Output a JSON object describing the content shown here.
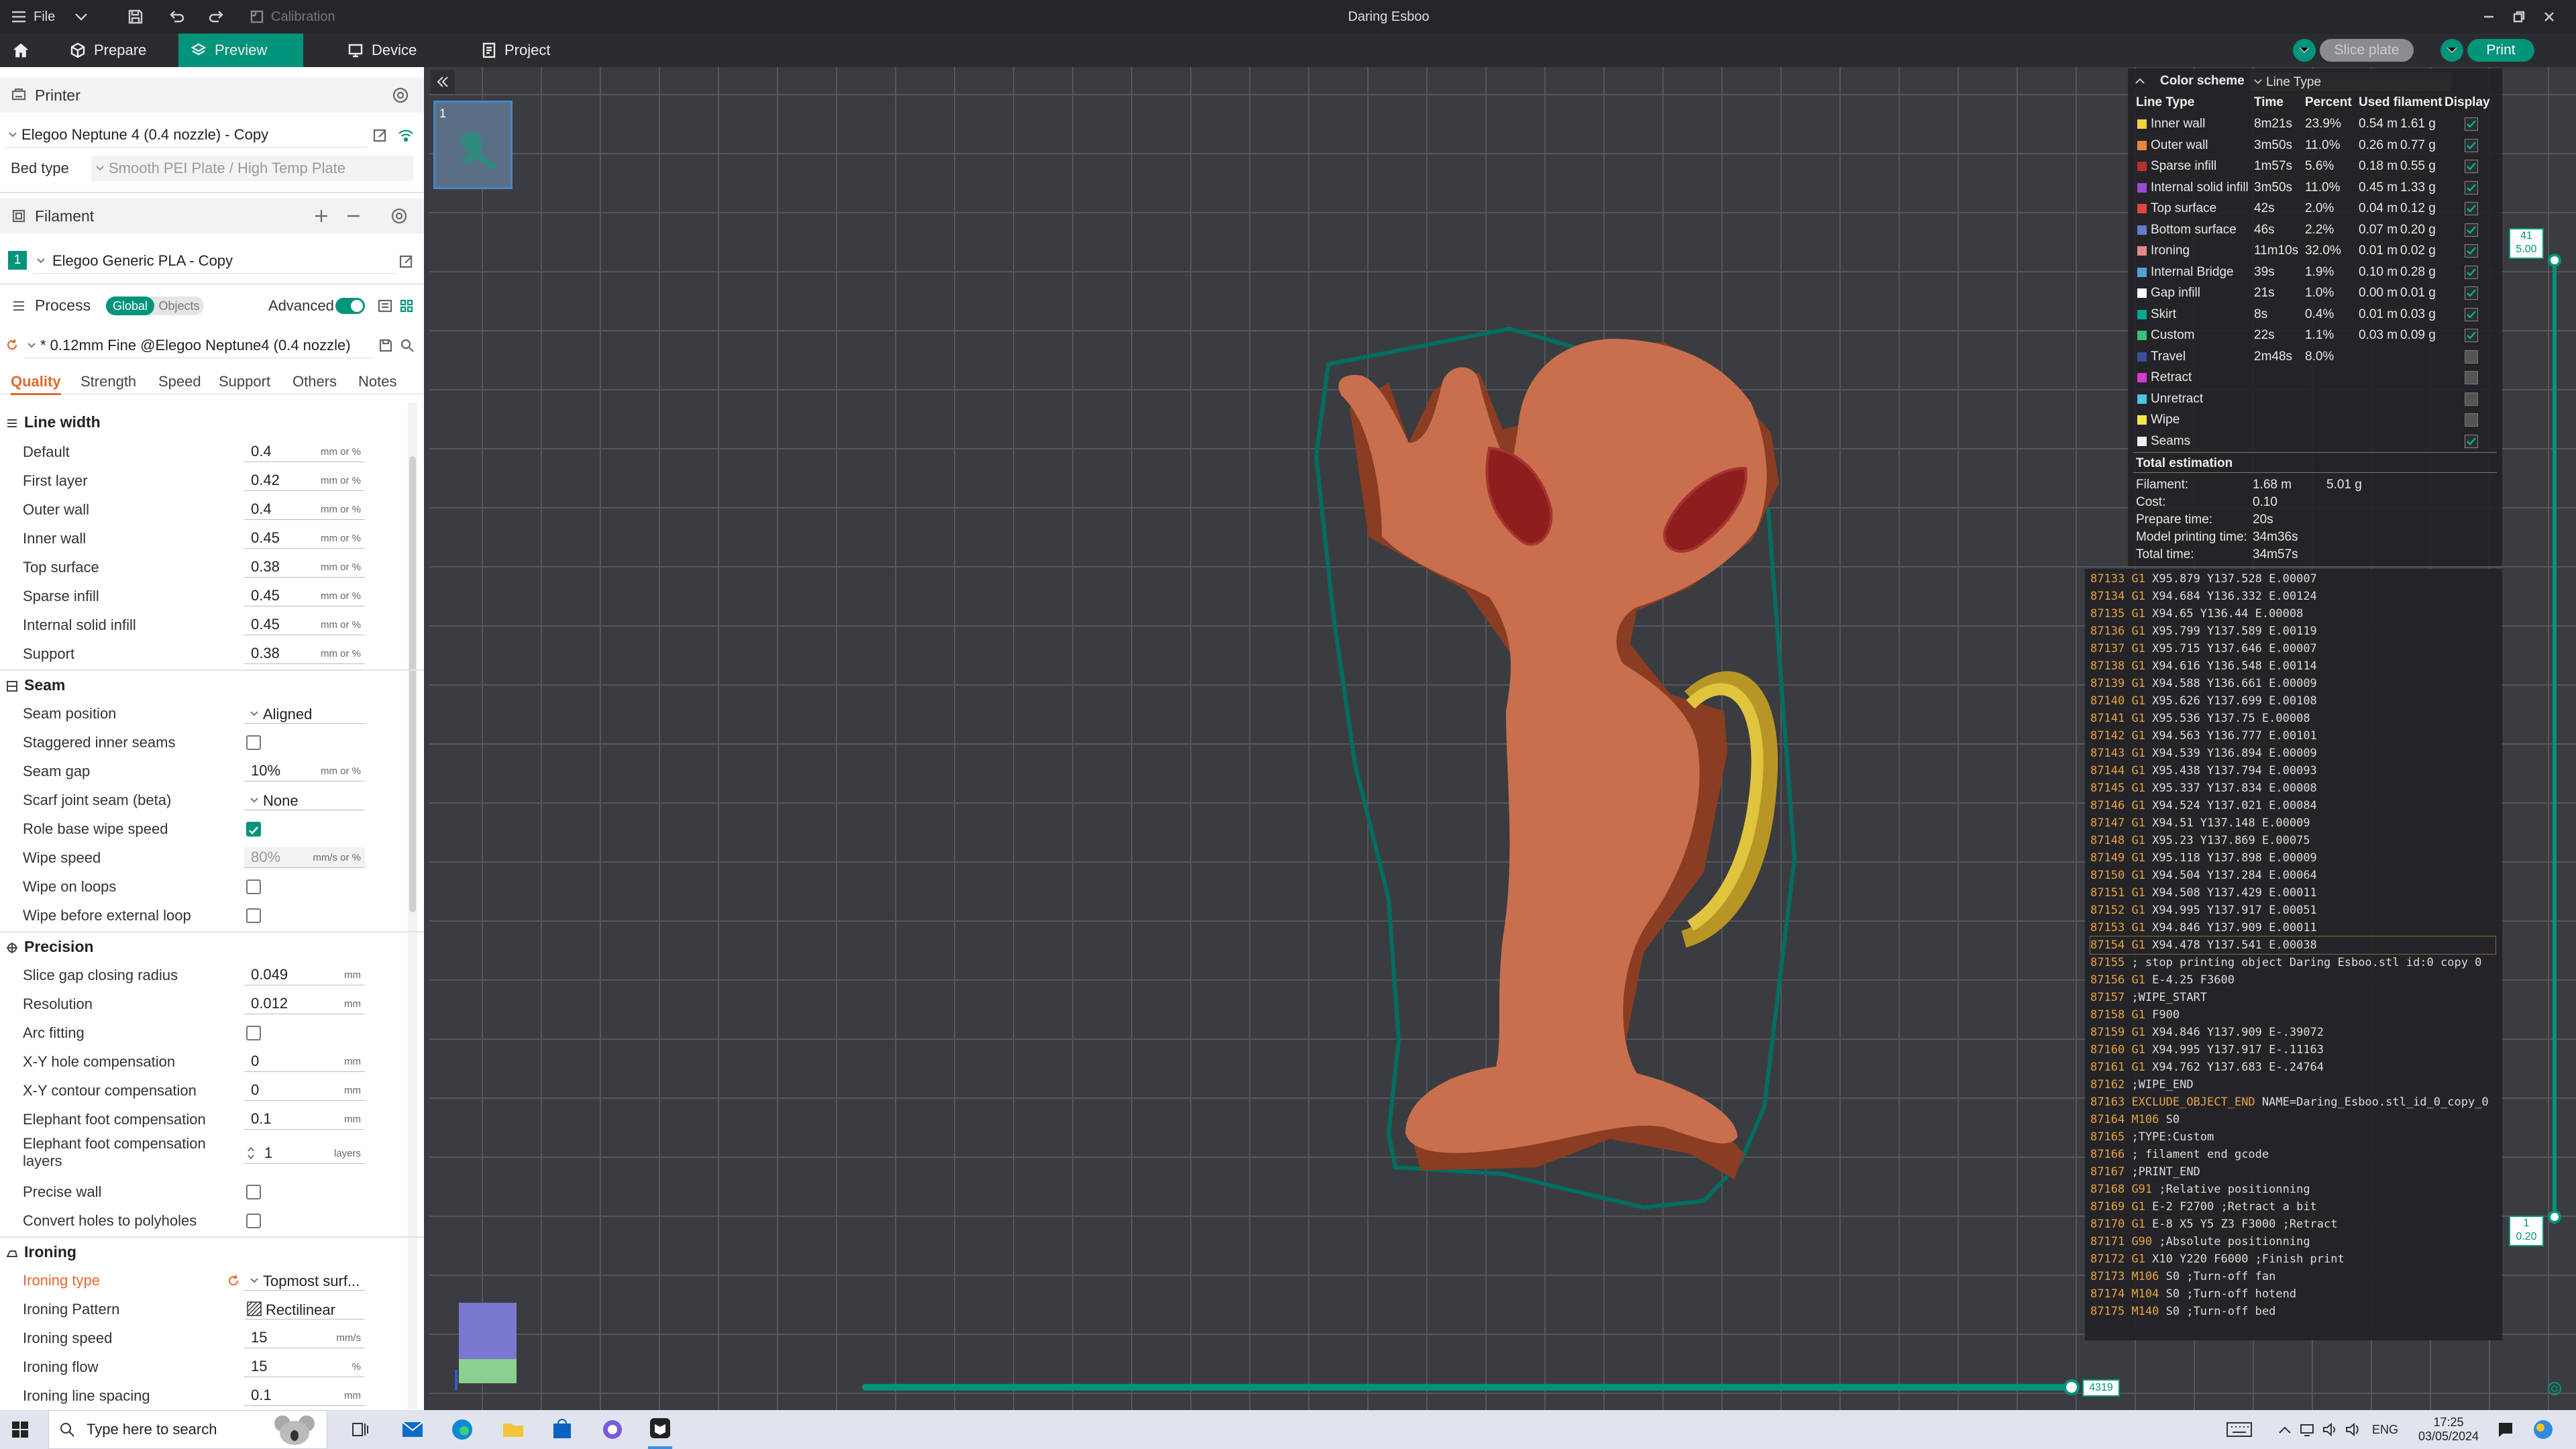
{
  "window": {
    "title": "Daring Esboo",
    "menu_file": "File",
    "calibration": "Calibration"
  },
  "nav": {
    "prepare": "Prepare",
    "preview": "Preview",
    "device": "Device",
    "project": "Project",
    "slice_plate": "Slice plate",
    "print": "Print"
  },
  "printer": {
    "header": "Printer",
    "name": "Elegoo Neptune 4 (0.4 nozzle) - Copy",
    "bed_type_label": "Bed type",
    "bed_type": "Smooth PEI Plate / High Temp Plate"
  },
  "filament": {
    "header": "Filament",
    "slot": "1",
    "name": "Elegoo Generic PLA - Copy"
  },
  "process": {
    "header": "Process",
    "global": "Global",
    "objects": "Objects",
    "advanced": "Advanced",
    "profile": "* 0.12mm Fine @Elegoo Neptune4 (0.4 nozzle)"
  },
  "tabs": [
    "Quality",
    "Strength",
    "Speed",
    "Support",
    "Others",
    "Notes"
  ],
  "line_width": {
    "title": "Line width",
    "rows": [
      {
        "label": "Default",
        "value": "0.4",
        "unit": "mm or %"
      },
      {
        "label": "First layer",
        "value": "0.42",
        "unit": "mm or %"
      },
      {
        "label": "Outer wall",
        "value": "0.4",
        "unit": "mm or %"
      },
      {
        "label": "Inner wall",
        "value": "0.45",
        "unit": "mm or %"
      },
      {
        "label": "Top surface",
        "value": "0.38",
        "unit": "mm or %"
      },
      {
        "label": "Sparse infill",
        "value": "0.45",
        "unit": "mm or %"
      },
      {
        "label": "Internal solid infill",
        "value": "0.45",
        "unit": "mm or %"
      },
      {
        "label": "Support",
        "value": "0.38",
        "unit": "mm or %"
      }
    ]
  },
  "seam": {
    "title": "Seam",
    "seam_position": "Seam position",
    "seam_position_value": "Aligned",
    "staggered": "Staggered inner seams",
    "seam_gap": "Seam gap",
    "seam_gap_value": "10%",
    "seam_gap_unit": "mm or %",
    "scarf": "Scarf joint seam (beta)",
    "scarf_value": "None",
    "role_base": "Role base wipe speed",
    "wipe_speed": "Wipe speed",
    "wipe_speed_value": "80%",
    "wipe_speed_unit": "mm/s or %",
    "wipe_loops": "Wipe on loops",
    "wipe_before": "Wipe before external loop"
  },
  "precision": {
    "title": "Precision",
    "rows": [
      {
        "label": "Slice gap closing radius",
        "value": "0.049",
        "unit": "mm"
      },
      {
        "label": "Resolution",
        "value": "0.012",
        "unit": "mm"
      }
    ],
    "arc_fitting": "Arc fitting",
    "rows2": [
      {
        "label": "X-Y hole compensation",
        "value": "0",
        "unit": "mm"
      },
      {
        "label": "X-Y contour compensation",
        "value": "0",
        "unit": "mm"
      },
      {
        "label": "Elephant foot compensation",
        "value": "0.1",
        "unit": "mm"
      }
    ],
    "efc_layers_label": "Elephant foot compensation layers",
    "efc_layers_value": "1",
    "efc_layers_unit": "layers",
    "precise_wall": "Precise wall",
    "convert_holes": "Convert holes to polyholes"
  },
  "ironing": {
    "title": "Ironing",
    "type_label": "Ironing type",
    "type_value": "Topmost surf...",
    "pattern_label": "Ironing Pattern",
    "pattern_value": "Rectilinear",
    "speed_label": "Ironing speed",
    "speed_value": "15",
    "speed_unit": "mm/s",
    "flow_label": "Ironing flow",
    "flow_value": "15",
    "flow_unit": "%",
    "spacing_label": "Ironing line spacing",
    "spacing_value": "0.1",
    "spacing_unit": "mm"
  },
  "plate_thumb": {
    "number": "1"
  },
  "legend": {
    "title": "Color scheme",
    "scheme": "Line Type",
    "col_type": "Line Type",
    "col_time": "Time",
    "col_percent": "Percent",
    "col_used": "Used filament",
    "col_display": "Display",
    "rows": [
      {
        "name": "Inner wall",
        "time": "8m21s",
        "percent": "23.9%",
        "len": "0.54 m",
        "g": "1.61 g",
        "color": "#f1d23f",
        "display": true
      },
      {
        "name": "Outer wall",
        "time": "3m50s",
        "percent": "11.0%",
        "len": "0.26 m",
        "g": "0.77 g",
        "color": "#f0843a",
        "display": true
      },
      {
        "name": "Sparse infill",
        "time": "1m57s",
        "percent": "5.6%",
        "len": "0.18 m",
        "g": "0.55 g",
        "color": "#b8302e",
        "display": true
      },
      {
        "name": "Internal solid infill",
        "time": "3m50s",
        "percent": "11.0%",
        "len": "0.45 m",
        "g": "1.33 g",
        "color": "#9a4bd4",
        "display": true
      },
      {
        "name": "Top surface",
        "time": "42s",
        "percent": "2.0%",
        "len": "0.04 m",
        "g": "0.12 g",
        "color": "#e0463f",
        "display": true
      },
      {
        "name": "Bottom surface",
        "time": "46s",
        "percent": "2.2%",
        "len": "0.07 m",
        "g": "0.20 g",
        "color": "#6b7ac8",
        "display": true
      },
      {
        "name": "Ironing",
        "time": "11m10s",
        "percent": "32.0%",
        "len": "0.01 m",
        "g": "0.02 g",
        "color": "#e38a8a",
        "display": true
      },
      {
        "name": "Internal Bridge",
        "time": "39s",
        "percent": "1.9%",
        "len": "0.10 m",
        "g": "0.28 g",
        "color": "#4fa3d9",
        "display": true
      },
      {
        "name": "Gap infill",
        "time": "21s",
        "percent": "1.0%",
        "len": "0.00 m",
        "g": "0.01 g",
        "color": "#ffffff",
        "display": true
      },
      {
        "name": "Skirt",
        "time": "8s",
        "percent": "0.4%",
        "len": "0.01 m",
        "g": "0.03 g",
        "color": "#00a98f",
        "display": true
      },
      {
        "name": "Custom",
        "time": "22s",
        "percent": "1.1%",
        "len": "0.03 m",
        "g": "0.09 g",
        "color": "#3cc07a",
        "display": true
      },
      {
        "name": "Travel",
        "time": "2m48s",
        "percent": "8.0%",
        "len": "",
        "g": "",
        "color": "#3c4d9a",
        "display": false
      },
      {
        "name": "Retract",
        "time": "",
        "percent": "",
        "len": "",
        "g": "",
        "color": "#d33bd3",
        "display": false
      },
      {
        "name": "Unretract",
        "time": "",
        "percent": "",
        "len": "",
        "g": "",
        "color": "#4ec3e8",
        "display": false
      },
      {
        "name": "Wipe",
        "time": "",
        "percent": "",
        "len": "",
        "g": "",
        "color": "#f3e94a",
        "display": false
      },
      {
        "name": "Seams",
        "time": "",
        "percent": "",
        "len": "",
        "g": "",
        "color": "#f0f0f0",
        "display": true
      }
    ],
    "total_title": "Total estimation",
    "totals": [
      {
        "label": "Filament:",
        "value": "1.68 m",
        "extra": "5.01 g"
      },
      {
        "label": "Cost:",
        "value": "0.10",
        "extra": ""
      },
      {
        "label": "Prepare time:",
        "value": "20s",
        "extra": ""
      },
      {
        "label": "Model printing time:",
        "value": "34m36s",
        "extra": ""
      },
      {
        "label": "Total time:",
        "value": "34m57s",
        "extra": ""
      }
    ]
  },
  "gcode": [
    {
      "n": "87133",
      "c": "G1",
      "t": " X95.879 Y137.528 E.00007"
    },
    {
      "n": "87134",
      "c": "G1",
      "t": " X94.684 Y136.332 E.00124"
    },
    {
      "n": "87135",
      "c": "G1",
      "t": " X94.65 Y136.44 E.00008"
    },
    {
      "n": "87136",
      "c": "G1",
      "t": " X95.799 Y137.589 E.00119"
    },
    {
      "n": "87137",
      "c": "G1",
      "t": " X95.715 Y137.646 E.00007"
    },
    {
      "n": "87138",
      "c": "G1",
      "t": " X94.616 Y136.548 E.00114"
    },
    {
      "n": "87139",
      "c": "G1",
      "t": " X94.588 Y136.661 E.00009"
    },
    {
      "n": "87140",
      "c": "G1",
      "t": " X95.626 Y137.699 E.00108"
    },
    {
      "n": "87141",
      "c": "G1",
      "t": " X95.536 Y137.75 E.00008"
    },
    {
      "n": "87142",
      "c": "G1",
      "t": " X94.563 Y136.777 E.00101"
    },
    {
      "n": "87143",
      "c": "G1",
      "t": " X94.539 Y136.894 E.00009"
    },
    {
      "n": "87144",
      "c": "G1",
      "t": " X95.438 Y137.794 E.00093"
    },
    {
      "n": "87145",
      "c": "G1",
      "t": " X95.337 Y137.834 E.00008"
    },
    {
      "n": "87146",
      "c": "G1",
      "t": " X94.524 Y137.021 E.00084"
    },
    {
      "n": "87147",
      "c": "G1",
      "t": " X94.51 Y137.148 E.00009"
    },
    {
      "n": "87148",
      "c": "G1",
      "t": " X95.23 Y137.869 E.00075"
    },
    {
      "n": "87149",
      "c": "G1",
      "t": " X95.118 Y137.898 E.00009"
    },
    {
      "n": "87150",
      "c": "G1",
      "t": " X94.504 Y137.284 E.00064"
    },
    {
      "n": "87151",
      "c": "G1",
      "t": " X94.508 Y137.429 E.00011"
    },
    {
      "n": "87152",
      "c": "G1",
      "t": " X94.995 Y137.917 E.00051"
    },
    {
      "n": "87153",
      "c": "G1",
      "t": " X94.846 Y137.909 E.00011"
    },
    {
      "n": "87154",
      "c": "G1",
      "t": " X94.478 Y137.541 E.00038"
    },
    {
      "n": "87155",
      "c": "",
      "t": " ; stop printing object Daring Esboo.stl id:0 copy 0"
    },
    {
      "n": "87156",
      "c": "G1",
      "t": " E-4.25 F3600"
    },
    {
      "n": "87157",
      "c": "",
      "t": " ;WIPE_START"
    },
    {
      "n": "87158",
      "c": "G1",
      "t": " F900"
    },
    {
      "n": "87159",
      "c": "G1",
      "t": " X94.846 Y137.909 E-.39072"
    },
    {
      "n": "87160",
      "c": "G1",
      "t": " X94.995 Y137.917 E-.11163"
    },
    {
      "n": "87161",
      "c": "G1",
      "t": " X94.762 Y137.683 E-.24764"
    },
    {
      "n": "87162",
      "c": "",
      "t": " ;WIPE_END"
    },
    {
      "n": "87163",
      "c": "EXCLUDE_OBJECT_END",
      "t": " NAME=Daring_Esboo.stl_id_0_copy_0"
    },
    {
      "n": "87164",
      "c": "M106",
      "t": " S0"
    },
    {
      "n": "87165",
      "c": "",
      "t": " ;TYPE:Custom"
    },
    {
      "n": "87166",
      "c": "",
      "t": " ; filament end gcode"
    },
    {
      "n": "87167",
      "c": "",
      "t": " ;PRINT_END"
    },
    {
      "n": "87168",
      "c": "G91",
      "t": " ;Relative positionning"
    },
    {
      "n": "87169",
      "c": "G1",
      "t": " E-2 F2700 ;Retract a bit"
    },
    {
      "n": "87170",
      "c": "G1",
      "t": " E-8 X5 Y5 Z3 F3000 ;Retract"
    },
    {
      "n": "87171",
      "c": "G90",
      "t": " ;Absolute positionning"
    },
    {
      "n": "87172",
      "c": "G1",
      "t": " X10 Y220 F6000 ;Finish print"
    },
    {
      "n": "87173",
      "c": "M106",
      "t": " S0 ;Turn-off fan"
    },
    {
      "n": "87174",
      "c": "M104",
      "t": " S0 ;Turn-off hotend"
    },
    {
      "n": "87175",
      "c": "M140",
      "t": " S0 ;Turn-off bed"
    }
  ],
  "layer_slider": {
    "top_layer": "41",
    "top_height": "5.00",
    "bottom_layer": "1",
    "bottom_height": "0.20",
    "move_value": "4319"
  },
  "taskbar": {
    "search_placeholder": "Type here to search",
    "lang": "ENG",
    "time": "17:25",
    "date": "03/05/2024"
  },
  "colors": {
    "accent": "#00947a",
    "model": "#c96f4e",
    "eye": "#8e1e1e",
    "skirt": "#00796b"
  }
}
